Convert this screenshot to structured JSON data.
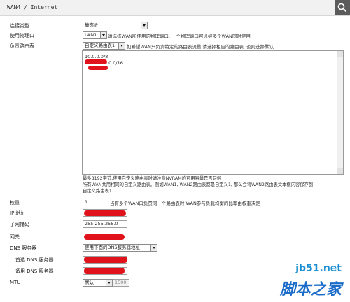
{
  "header": {
    "breadcrumb": "WAN4 / Internet",
    "search_icon": "search-icon"
  },
  "fields": {
    "conn_type": {
      "label": "连接类型",
      "value": "静态IP"
    },
    "phys_port": {
      "label": "使用物理口",
      "value": "LAN1",
      "hint": "请选择WAN所使用的物理端口, 一个物理端口可以被多个WAN同时使用"
    },
    "route_table": {
      "label": "负责路由表",
      "value": "自定义路由表1",
      "hint": "如希望WAN只负责特定的路由表流量,请选择相应的路由表, 否则选择默认"
    },
    "routes": {
      "line1": "10.0.0.0/8",
      "line2_suffix": ".0.0/16"
    },
    "route_notes": [
      "最多8192字节,使用自定义路由表时请注意NVRAM的可用容量是否足够",
      "所有WAN共用相同的自定义路由表。例如WAN1, WAN2路由表都是自定义1, 那么会将WAN2路由表文本框内容保存到",
      "自定义路由表1"
    ],
    "weight": {
      "label": "权重",
      "value": "1",
      "hint": "当有多个WAN口负责同一个路由表时,WAN参与负载均衡的比率由权重决定"
    },
    "ip": {
      "label": "IP 地址"
    },
    "mask": {
      "label": "子网掩码",
      "value": "255.255.255.0"
    },
    "gateway": {
      "label": "网关"
    },
    "dns": {
      "label": "DNS 服务器",
      "value": "使用下面的DNS服务器地址"
    },
    "dns1": {
      "label": "首选 DNS 服务器"
    },
    "dns2": {
      "label": "备用 DNS 服务器"
    },
    "mtu": {
      "label": "MTU",
      "value": "默认",
      "number": "1500"
    }
  },
  "watermark": {
    "site": "jb51.net",
    "name": "脚本之家"
  },
  "colors": {
    "redaction": "#e0121b",
    "watermark": "#1b8fd1"
  }
}
